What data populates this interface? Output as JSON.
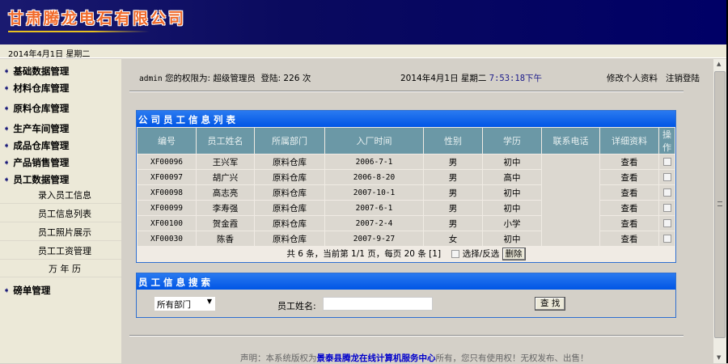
{
  "company": "甘肃腾龙电石有限公司",
  "date_bar": "2014年4月1日 星期二",
  "sidebar": {
    "items": [
      "基础数据管理",
      "材料仓库管理",
      "原料仓库管理",
      "生产车间管理",
      "成品仓库管理",
      "产品销售管理",
      "员工数据管理"
    ],
    "sub_items": [
      "录入员工信息",
      "员工信息列表",
      "员工照片展示",
      "员工工资管理",
      "万 年 历"
    ],
    "last_item": "磅单管理"
  },
  "topinfo": {
    "user": "admin",
    "perm_label": "您的权限为:",
    "role": "超级管理员",
    "login_label": "登陆:",
    "login_count": "226",
    "login_unit": "次",
    "date": "2014年4月1日 星期二",
    "time": "7:53:18下午",
    "edit_profile": "修改个人资料",
    "logout": "注销登陆"
  },
  "list": {
    "title": "公司员工信息列表",
    "headers": [
      "编号",
      "员工姓名",
      "所属部门",
      "入厂时间",
      "性别",
      "学历",
      "联系电话",
      "详细资料",
      "操 作"
    ],
    "rows": [
      [
        "XF00096",
        "王兴军",
        "原料仓库",
        "2006-7-1",
        "男",
        "初中",
        "",
        "查看"
      ],
      [
        "XF00097",
        "胡广兴",
        "原料仓库",
        "2006-8-20",
        "男",
        "高中",
        "",
        "查看"
      ],
      [
        "XF00098",
        "高志亮",
        "原料仓库",
        "2007-10-1",
        "男",
        "初中",
        "",
        "查看"
      ],
      [
        "XF00099",
        "李寿强",
        "原料仓库",
        "2007-6-1",
        "男",
        "初中",
        "",
        "查看"
      ],
      [
        "XF00100",
        "贺金霞",
        "原料仓库",
        "2007-2-4",
        "男",
        "小学",
        "",
        "查看"
      ],
      [
        "XF00030",
        "陈香",
        "原料仓库",
        "2007-9-27",
        "女",
        "初中",
        "",
        "查看"
      ]
    ],
    "pagination": "共 6 条，当前第 1/1 页，每页 20 条 [1]",
    "select_toggle": "选择/反选",
    "delete": "删除"
  },
  "search": {
    "title": "员工信息搜索",
    "dept": "所有部门",
    "name_label": "员工姓名:",
    "name_value": "",
    "button": "查 找"
  },
  "footer": {
    "prefix": "声明：本系统版权为",
    "link": "景泰县腾龙在线计算机服务中心",
    "suffix": "所有，您只有使用权！无权发布、出售！"
  },
  "colors": {
    "title_bar": "#0055e5",
    "header_cell": "#6b98a6",
    "link": "#0000cc"
  }
}
